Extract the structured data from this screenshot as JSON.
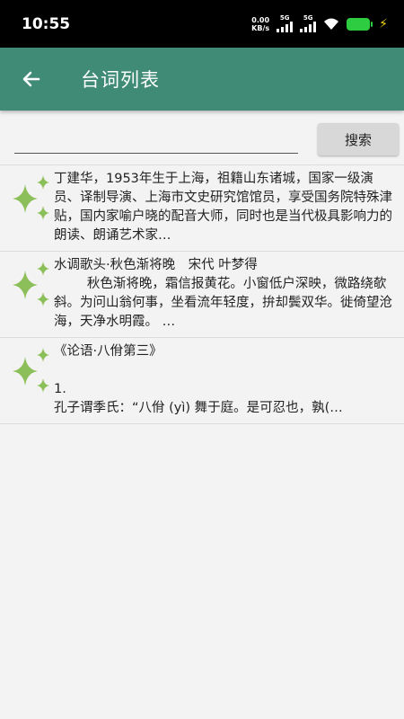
{
  "status_bar": {
    "time": "10:55",
    "net_speed_value": "0.00",
    "net_speed_unit": "KB/s",
    "signal1_label": "5G",
    "signal2_label": "5G",
    "battery_color": "#2ecc40"
  },
  "app_bar": {
    "title": "台词列表",
    "back_icon": "arrow-left-icon",
    "color": "#3f8b75"
  },
  "search": {
    "value": "",
    "placeholder": "",
    "button_label": "搜索"
  },
  "items": [
    {
      "icon": "sparkle-icon",
      "text": "丁建华，1953年生于上海，祖籍山东诸城，国家一级演员、译制导演、上海市文史研究馆馆员，享受国务院特殊津贴，国内家喻户晓的配音大师，同时也是当代极具影响力的朗读、朗诵艺术家…"
    },
    {
      "icon": "sparkle-icon",
      "text": "水调歌头·秋色渐将晚　宋代 叶梦得\n        秋色渐将晚，霜信报黄花。小窗低户深映，微路绕欹斜。为问山翁何事，坐看流年轻度，拚却鬓双华。徙倚望沧海，天净水明霞。 …"
    },
    {
      "icon": "sparkle-icon",
      "text": "《论语·八佾第三》\n\n1.\n孔子谓季氏：“八佾 (yì) 舞于庭。是可忍也，孰(…"
    }
  ]
}
